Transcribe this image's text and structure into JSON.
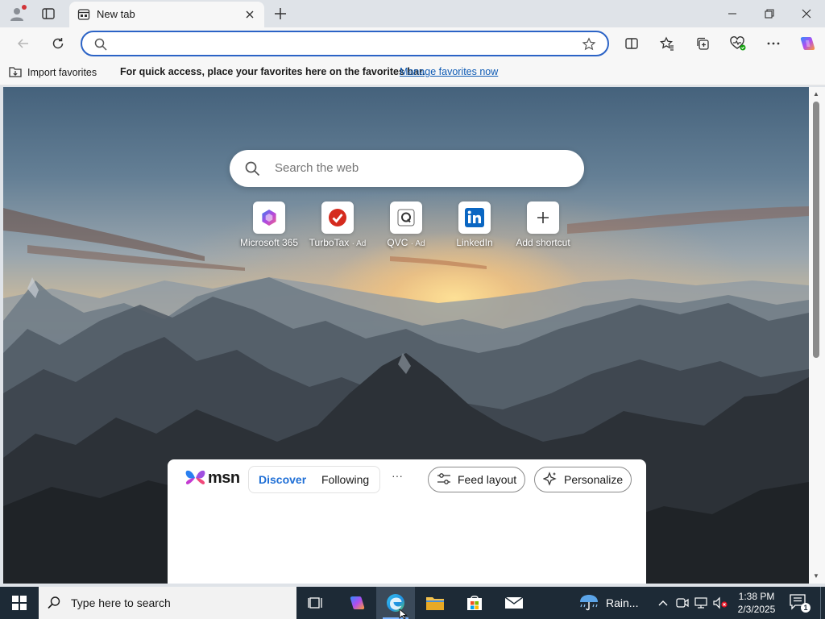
{
  "tab": {
    "title": "New tab"
  },
  "omnibox": {
    "value": "",
    "placeholder": ""
  },
  "favorites_bar": {
    "import_label": "Import favorites",
    "message": "For quick access, place your favorites here on the favorites bar.",
    "manage_link": "Manage favorites now"
  },
  "page_search": {
    "placeholder": "Search the web"
  },
  "shortcuts": [
    {
      "label": "Microsoft 365",
      "ad": "",
      "icon": "microsoft-365-icon"
    },
    {
      "label": "TurboTax",
      "ad": "· Ad",
      "icon": "turbotax-icon"
    },
    {
      "label": "QVC",
      "ad": "· Ad",
      "icon": "qvc-icon"
    },
    {
      "label": "LinkedIn",
      "ad": "",
      "icon": "linkedin-icon"
    },
    {
      "label": "Add shortcut",
      "ad": "",
      "icon": "plus-icon"
    }
  ],
  "msn": {
    "logo_text": "msn",
    "tabs": [
      "Discover",
      "Following"
    ],
    "active_tab": "Discover",
    "more": "···",
    "feed_layout": "Feed layout",
    "personalize": "Personalize"
  },
  "taskbar": {
    "search_placeholder": "Type here to search",
    "weather": "Rain...",
    "time": "1:38 PM",
    "date": "2/3/2025",
    "notification_count": "1"
  },
  "colors": {
    "accent": "#2b63c6",
    "link": "#0f5bb5",
    "taskbar": "#1d2a36",
    "active_tab_text": "#1f6fd6"
  }
}
